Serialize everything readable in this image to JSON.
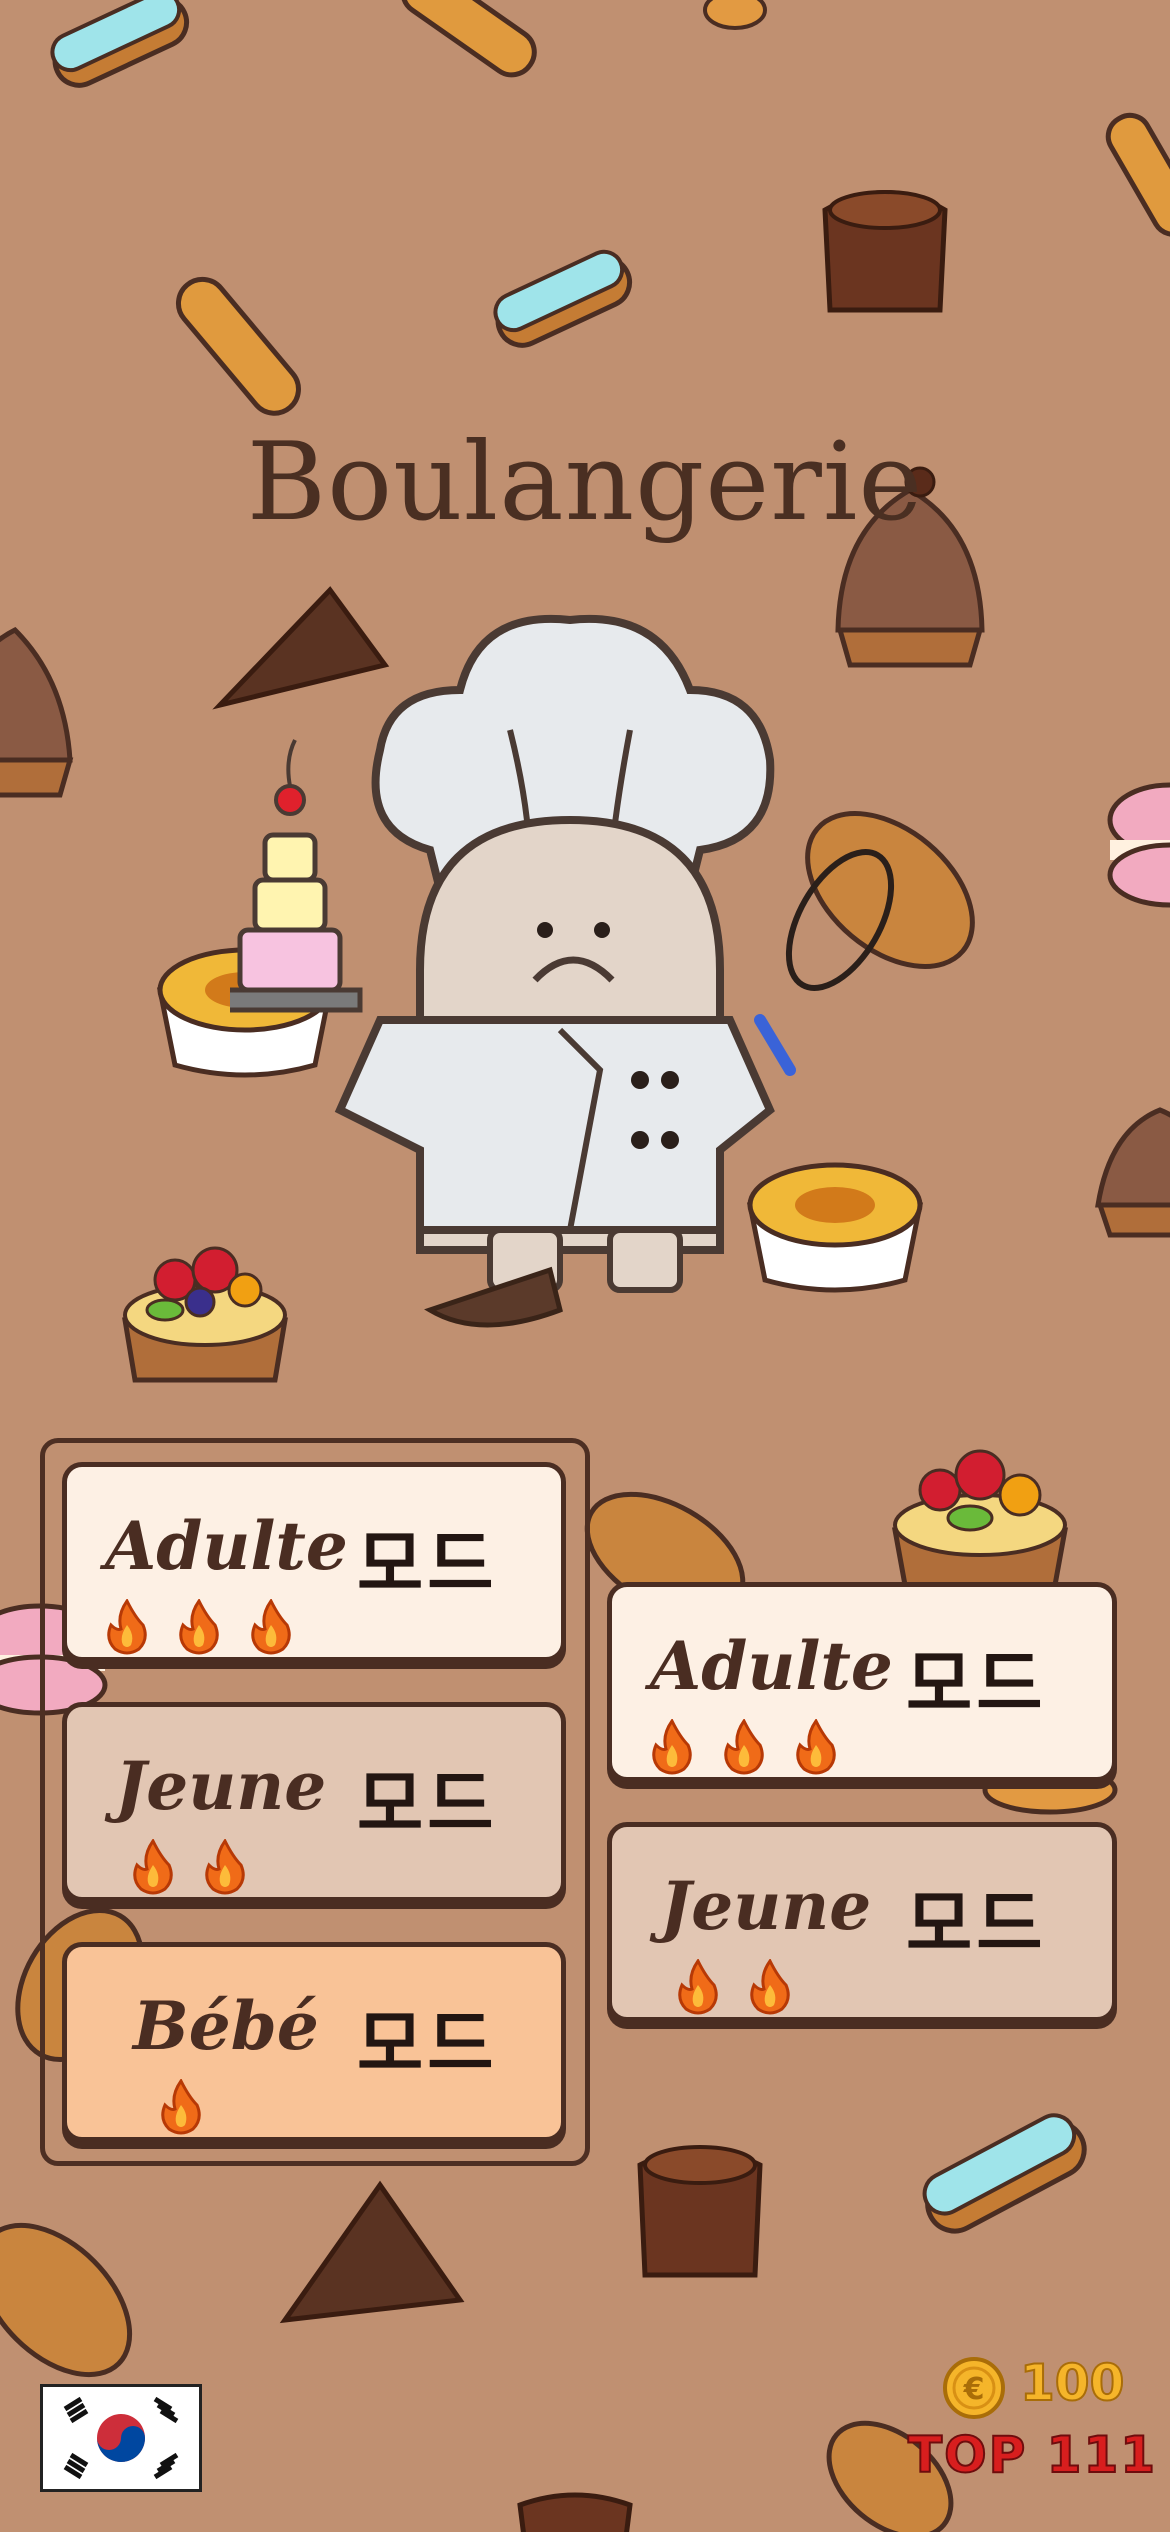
{
  "title": "Boulangerie",
  "left_modes": [
    {
      "label": "Adulte",
      "mode": "모드",
      "flames": 3
    },
    {
      "label": "Jeune",
      "mode": "모드",
      "flames": 2
    },
    {
      "label": "Bébé",
      "mode": "모드",
      "flames": 1
    }
  ],
  "right_modes": [
    {
      "label": "Adulte",
      "mode": "모드",
      "flames": 3
    },
    {
      "label": "Jeune",
      "mode": "모드",
      "flames": 2
    }
  ],
  "hud": {
    "coins": "100",
    "rank": "TOP 111"
  },
  "colors": {
    "background": "#c09071",
    "card_cream": "#fdf0e4",
    "card_tan": "#e2c6b3",
    "card_peach": "#f9c397",
    "flame": "#f06b18"
  },
  "icons": [
    "bakery-background-pattern",
    "chef-character",
    "flame-icon",
    "coin-icon",
    "korea-flag-icon"
  ]
}
